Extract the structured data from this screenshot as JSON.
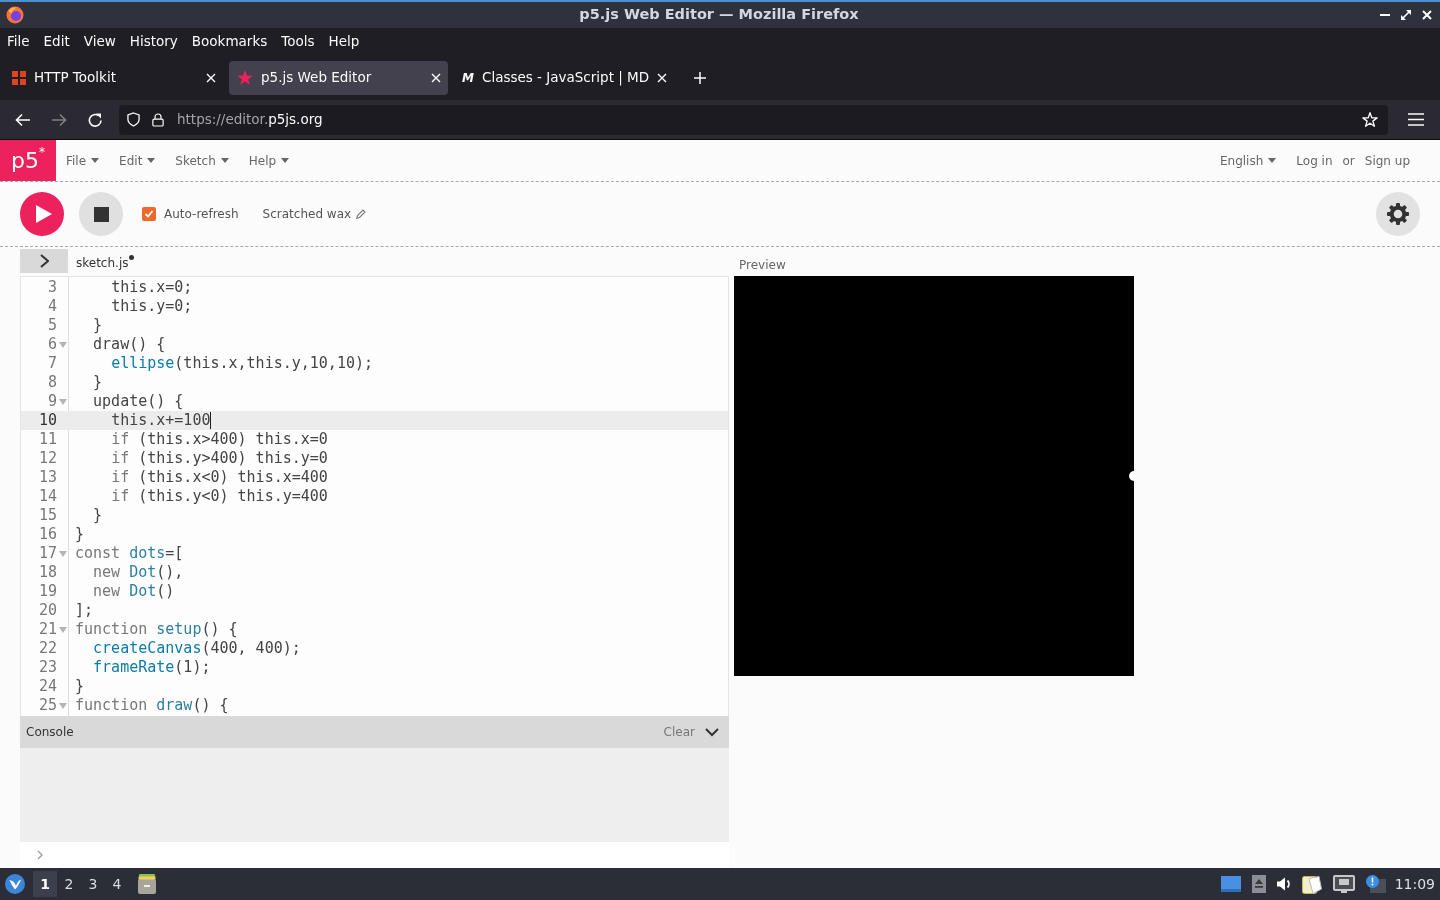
{
  "window": {
    "title": "p5.js Web Editor — Mozilla Firefox"
  },
  "menu_bar": [
    "File",
    "Edit",
    "View",
    "History",
    "Bookmarks",
    "Tools",
    "Help"
  ],
  "tabs": [
    {
      "title": "HTTP Toolkit",
      "kind": "blocks",
      "selected": false
    },
    {
      "title": "p5.js Web Editor",
      "kind": "star",
      "selected": true
    },
    {
      "title": "Classes - JavaScript | MD",
      "kind": "letter",
      "icon_text": "M",
      "selected": false
    }
  ],
  "nav_buttons": [
    {
      "kind": "back",
      "disabled": false
    },
    {
      "kind": "forward",
      "disabled": true
    },
    {
      "kind": "reload",
      "disabled": false
    }
  ],
  "address_bar": {
    "url_dim": "https://editor.",
    "url_host": "p5js.org"
  },
  "app": {
    "logo": "p5$^{*}$",
    "menus": [
      "File",
      "Edit",
      "Sketch",
      "Help"
    ],
    "language": "English",
    "login": "Log in",
    "separator": "or",
    "signup": "Sign up"
  },
  "toolbar": {
    "auto_refresh": {
      "label": "Auto-refresh",
      "checked": true
    },
    "sketch_name": "Scratched wax"
  },
  "editor": {
    "sidebar": {
      "expanded": false
    },
    "file": {
      "name": "sketch.js",
      "unsaved": true
    },
    "lines": [
      {
        "number": "3",
        "foldable": false,
        "current": false,
        "tokens": [
          {
            "text": "    this.x=0;",
            "kind": "plain"
          }
        ]
      },
      {
        "number": "4",
        "foldable": false,
        "current": false,
        "tokens": [
          {
            "text": "    this.y=0;",
            "kind": "plain"
          }
        ]
      },
      {
        "number": "5",
        "foldable": false,
        "current": false,
        "tokens": [
          {
            "text": "  }",
            "kind": "plain"
          }
        ]
      },
      {
        "number": "6",
        "foldable": true,
        "current": false,
        "tokens": [
          {
            "text": "  draw() {",
            "kind": "plain"
          }
        ]
      },
      {
        "number": "7",
        "foldable": false,
        "current": false,
        "tokens": [
          {
            "text": "    ellipse",
            "kind": "builtin"
          },
          {
            "text": "(this.x,this.y,10,10);",
            "kind": "plain"
          }
        ]
      },
      {
        "number": "8",
        "foldable": false,
        "current": false,
        "tokens": [
          {
            "text": "  }",
            "kind": "plain"
          }
        ]
      },
      {
        "number": "9",
        "foldable": true,
        "current": false,
        "tokens": [
          {
            "text": "  update() {",
            "kind": "plain"
          }
        ]
      },
      {
        "number": "10",
        "foldable": false,
        "current": true,
        "tokens": [
          {
            "text": "    this.x+=100",
            "kind": "plain"
          }
        ]
      },
      {
        "number": "11",
        "foldable": false,
        "current": false,
        "tokens": [
          {
            "text": "    if",
            "kind": "keyword"
          },
          {
            "text": " (this.x>400) this.x=0",
            "kind": "plain"
          }
        ]
      },
      {
        "number": "12",
        "foldable": false,
        "current": false,
        "tokens": [
          {
            "text": "    if",
            "kind": "keyword"
          },
          {
            "text": " (this.y>400) this.y=0",
            "kind": "plain"
          }
        ]
      },
      {
        "number": "13",
        "foldable": false,
        "current": false,
        "tokens": [
          {
            "text": "    if",
            "kind": "keyword"
          },
          {
            "text": " (this.x<0) this.x=400",
            "kind": "plain"
          }
        ]
      },
      {
        "number": "14",
        "foldable": false,
        "current": false,
        "tokens": [
          {
            "text": "    if",
            "kind": "keyword"
          },
          {
            "text": " (this.y<0) this.y=400",
            "kind": "plain"
          }
        ]
      },
      {
        "number": "15",
        "foldable": false,
        "current": false,
        "tokens": [
          {
            "text": "  }",
            "kind": "plain"
          }
        ]
      },
      {
        "number": "16",
        "foldable": false,
        "current": false,
        "tokens": [
          {
            "text": "}",
            "kind": "plain"
          }
        ]
      },
      {
        "number": "17",
        "foldable": true,
        "current": false,
        "tokens": [
          {
            "text": "const",
            "kind": "keyword"
          },
          {
            "text": " dots",
            "kind": "def"
          },
          {
            "text": "=[",
            "kind": "plain"
          }
        ]
      },
      {
        "number": "18",
        "foldable": false,
        "current": false,
        "tokens": [
          {
            "text": "  new",
            "kind": "keyword"
          },
          {
            "text": " Dot",
            "kind": "def"
          },
          {
            "text": "(),",
            "kind": "plain"
          }
        ]
      },
      {
        "number": "19",
        "foldable": false,
        "current": false,
        "tokens": [
          {
            "text": "  new",
            "kind": "keyword"
          },
          {
            "text": " Dot",
            "kind": "def"
          },
          {
            "text": "()",
            "kind": "plain"
          }
        ]
      },
      {
        "number": "20",
        "foldable": false,
        "current": false,
        "tokens": [
          {
            "text": "];",
            "kind": "plain"
          }
        ]
      },
      {
        "number": "21",
        "foldable": true,
        "current": false,
        "tokens": [
          {
            "text": "function",
            "kind": "keyword"
          },
          {
            "text": " setup",
            "kind": "def"
          },
          {
            "text": "() {",
            "kind": "plain"
          }
        ]
      },
      {
        "number": "22",
        "foldable": false,
        "current": false,
        "tokens": [
          {
            "text": "  createCanvas",
            "kind": "builtin"
          },
          {
            "text": "(400, 400);",
            "kind": "plain"
          }
        ]
      },
      {
        "number": "23",
        "foldable": false,
        "current": false,
        "tokens": [
          {
            "text": "  frameRate",
            "kind": "builtin"
          },
          {
            "text": "(1);",
            "kind": "plain"
          }
        ]
      },
      {
        "number": "24",
        "foldable": false,
        "current": false,
        "tokens": [
          {
            "text": "}",
            "kind": "plain"
          }
        ]
      },
      {
        "number": "25",
        "foldable": true,
        "current": false,
        "tokens": [
          {
            "text": "function",
            "kind": "keyword"
          },
          {
            "text": " draw",
            "kind": "def"
          },
          {
            "text": "() {",
            "kind": "plain"
          }
        ]
      }
    ]
  },
  "console": {
    "title": "Console",
    "clear": "Clear"
  },
  "preview": {
    "label": "Preview"
  },
  "taskbar": {
    "workspaces": [
      {
        "label": "1",
        "selected": true
      },
      {
        "label": "2",
        "selected": false
      },
      {
        "label": "3",
        "selected": false
      },
      {
        "label": "4",
        "selected": false
      }
    ],
    "clock": "11:09"
  }
}
